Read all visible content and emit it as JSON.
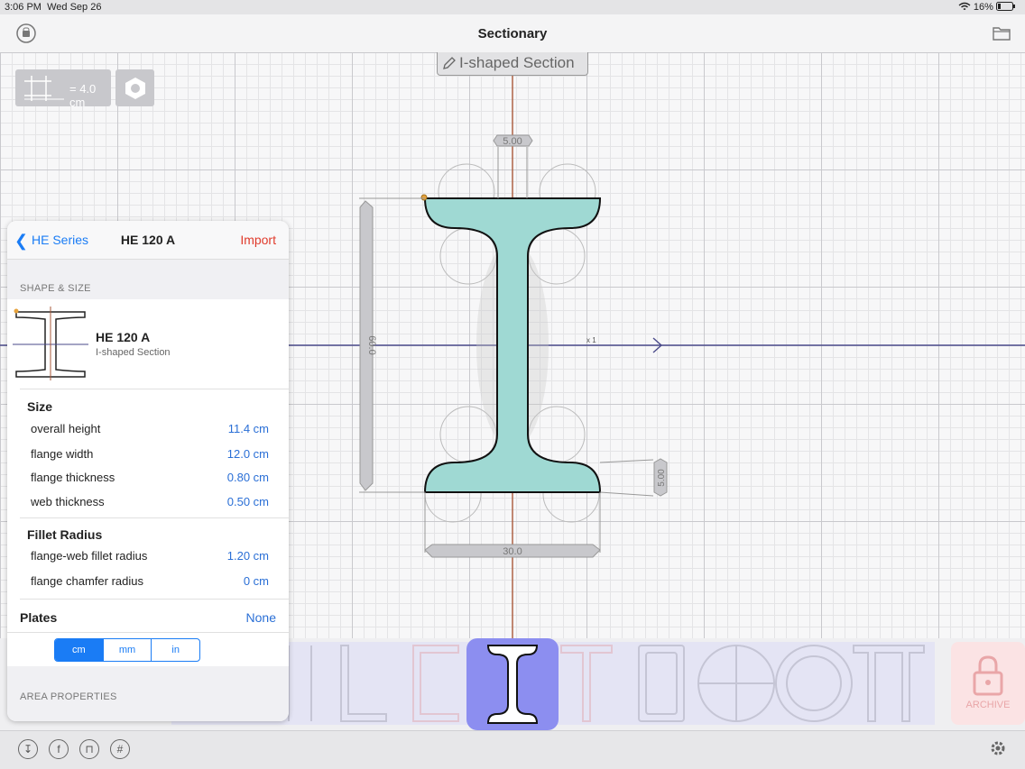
{
  "status": {
    "time": "3:06 PM",
    "date": "Wed Sep 26",
    "battery": "16%"
  },
  "navbar": {
    "title": "Sectionary"
  },
  "canvas": {
    "scale_label": "= 4.0 cm",
    "section_tag": "I-shaped Section",
    "dims": {
      "top_thickness": "5.00",
      "height": "60.0",
      "flange_thickness": "5.00",
      "width": "30.0"
    },
    "axis_label": "x 1"
  },
  "panel": {
    "back_label": "HE Series",
    "title": "HE 120 A",
    "import_label": "Import",
    "shape_size_label": "SHAPE & SIZE",
    "profile": {
      "name": "HE 120 A",
      "type": "I-shaped Section"
    },
    "size_heading": "Size",
    "size_rows": [
      {
        "label": "overall height",
        "value": "11.4 cm"
      },
      {
        "label": "flange width",
        "value": "12.0 cm"
      },
      {
        "label": "flange thickness",
        "value": "0.80 cm"
      },
      {
        "label": "web thickness",
        "value": "0.50 cm"
      }
    ],
    "fillet_heading": "Fillet Radius",
    "fillet_rows": [
      {
        "label": "flange-web fillet radius",
        "value": "1.20 cm"
      },
      {
        "label": "flange chamfer radius",
        "value": "0 cm"
      }
    ],
    "plates": {
      "label": "Plates",
      "value": "None"
    },
    "units": [
      "cm",
      "mm",
      "in"
    ],
    "area_label": "AREA PROPERTIES"
  },
  "palette": {
    "archive_label": "ARCHIVE"
  },
  "colors": {
    "accent": "#1a7cf5",
    "section_fill": "#9fd9d3",
    "selection": "#8c8ef0",
    "import": "#e03b2c"
  }
}
